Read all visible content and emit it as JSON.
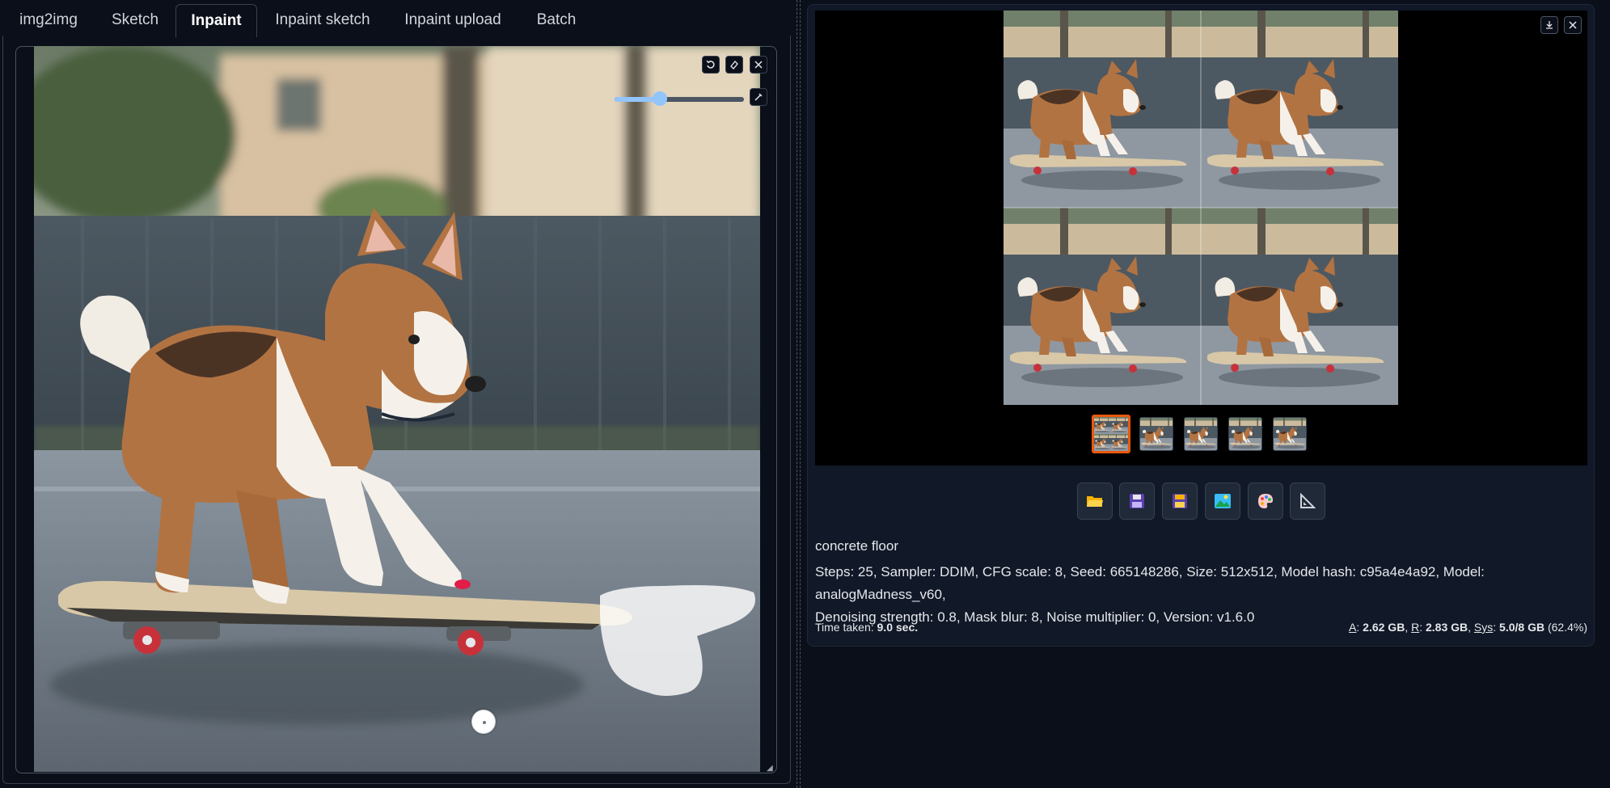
{
  "tabs": [
    {
      "label": "img2img",
      "active": false
    },
    {
      "label": "Sketch",
      "active": false
    },
    {
      "label": "Inpaint",
      "active": true
    },
    {
      "label": "Inpaint sketch",
      "active": false
    },
    {
      "label": "Inpaint upload",
      "active": false
    },
    {
      "label": "Batch",
      "active": false
    }
  ],
  "canvas": {
    "tools": [
      "undo-icon",
      "eraser-icon",
      "close-icon",
      "brush-icon"
    ],
    "brush_size": 0.35,
    "colors": {
      "slider": "#93c5fd",
      "mask": "#ffffff"
    }
  },
  "gallery": {
    "thumbnail_count": 5,
    "selected_index": 0,
    "selected_color": "#ea580c",
    "corner_buttons": [
      "download-icon",
      "close-icon"
    ]
  },
  "actions": [
    "folder-icon",
    "save-icon",
    "zip-icon",
    "send-to-img2img-icon",
    "send-to-inpaint-icon",
    "send-to-extras-icon"
  ],
  "info": {
    "prompt": "concrete floor",
    "params_line1": "Steps: 25, Sampler: DDIM, CFG scale: 8, Seed: 665148286, Size: 512x512, Model hash: c95a4e4a92, Model: analogMadness_v60,",
    "params_line2": "Denoising strength: 0.8, Mask blur: 8, Noise multiplier: 0, Version: v1.6.0"
  },
  "stats": {
    "time_label": "Time taken:",
    "time_value": "9.0 sec.",
    "a_label": "A",
    "a_value": "2.62 GB",
    "r_label": "R",
    "r_value": "2.83 GB",
    "sys_label": "Sys",
    "sys_value": "5.0/8 GB",
    "sys_pct": "(62.4%)"
  }
}
